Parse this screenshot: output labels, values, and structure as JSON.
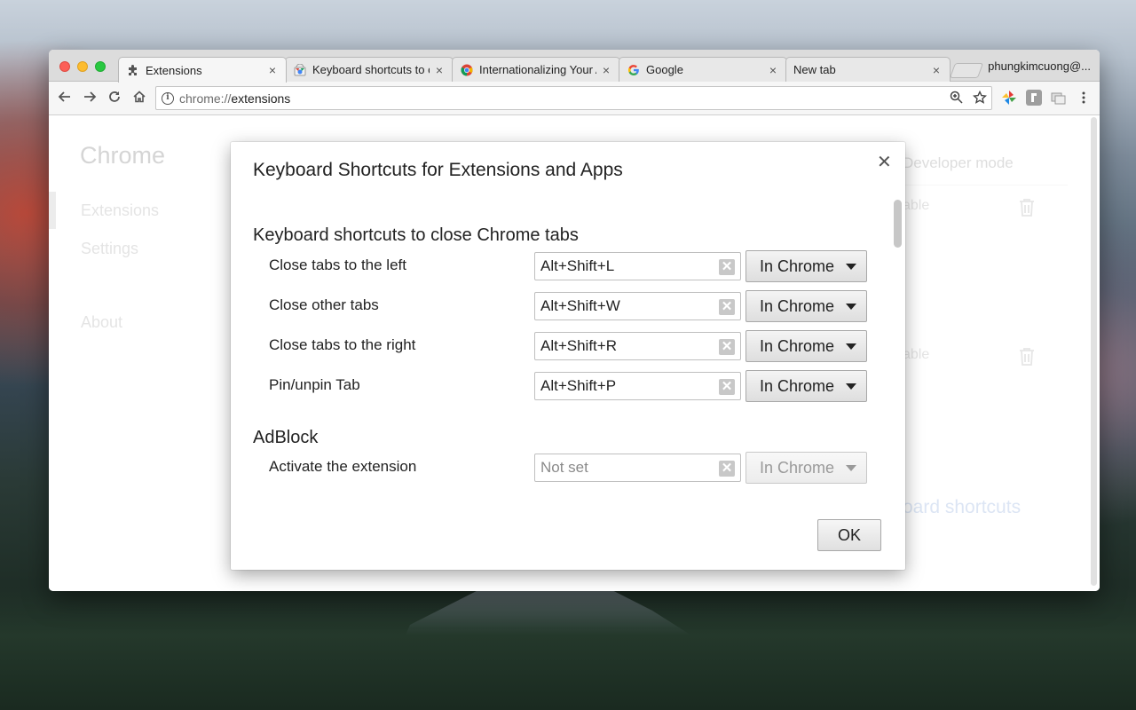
{
  "browser": {
    "tabs": [
      {
        "title": "Extensions",
        "icon": "puzzle-icon",
        "active": true
      },
      {
        "title": "Keyboard shortcuts to c",
        "icon": "chrome-web-store-icon",
        "active": false
      },
      {
        "title": "Internationalizing Your A",
        "icon": "chrome-icon",
        "active": false
      },
      {
        "title": "Google",
        "icon": "google-icon",
        "active": false
      },
      {
        "title": "New tab",
        "icon": "",
        "active": false
      }
    ],
    "profile_name": "phungkimcuong@...",
    "close_glyph": "×",
    "address": {
      "scheme": "chrome://",
      "host": "extensions"
    }
  },
  "page": {
    "sidebar": {
      "title": "Chrome",
      "items": [
        "Extensions",
        "Settings",
        "About"
      ]
    },
    "developer_mode_label": "Developer mode",
    "enable_labels": [
      "able",
      "able"
    ],
    "keyboard_shortcuts_link": "oard shortcuts"
  },
  "dialog": {
    "title": "Keyboard Shortcuts for Extensions and Apps",
    "close_glyph": "✕",
    "sections": [
      {
        "heading": "Keyboard shortcuts to close Chrome tabs",
        "commands": [
          {
            "label": "Close tabs to the left",
            "shortcut": "Alt+Shift+L",
            "scope": "In Chrome"
          },
          {
            "label": "Close other tabs",
            "shortcut": "Alt+Shift+W",
            "scope": "In Chrome"
          },
          {
            "label": "Close tabs to the right",
            "shortcut": "Alt+Shift+R",
            "scope": "In Chrome"
          },
          {
            "label": "Pin/unpin Tab",
            "shortcut": "Alt+Shift+P",
            "scope": "In Chrome"
          }
        ]
      },
      {
        "heading": "AdBlock",
        "commands": [
          {
            "label": "Activate the extension",
            "shortcut": "Not set",
            "scope": "In Chrome",
            "disabled": true
          }
        ]
      }
    ],
    "clear_glyph": "✕",
    "ok_label": "OK"
  },
  "colors": {
    "accent_link": "#b8cbe8",
    "traffic_close": "#fc5f57",
    "traffic_min": "#fdbc2e",
    "traffic_max": "#28c840"
  }
}
